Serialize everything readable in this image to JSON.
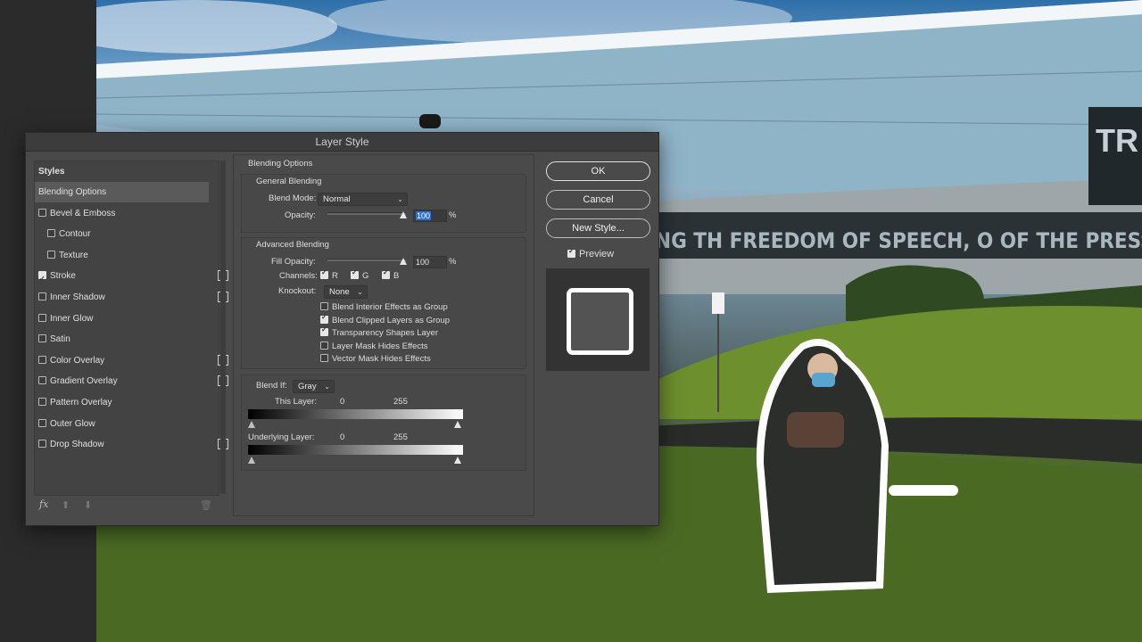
{
  "dialog": {
    "title": "Layer Style",
    "styles_header": "Styles",
    "styles": [
      {
        "label": "Blending Options",
        "checkbox": false,
        "checked": false,
        "active": true,
        "plus": false,
        "indent": false
      },
      {
        "label": "Bevel & Emboss",
        "checkbox": true,
        "checked": false,
        "active": false,
        "plus": false,
        "indent": false
      },
      {
        "label": "Contour",
        "checkbox": true,
        "checked": false,
        "active": false,
        "plus": false,
        "indent": true
      },
      {
        "label": "Texture",
        "checkbox": true,
        "checked": false,
        "active": false,
        "plus": false,
        "indent": true
      },
      {
        "label": "Stroke",
        "checkbox": true,
        "checked": true,
        "active": false,
        "plus": true,
        "indent": false
      },
      {
        "label": "Inner Shadow",
        "checkbox": true,
        "checked": false,
        "active": false,
        "plus": true,
        "indent": false
      },
      {
        "label": "Inner Glow",
        "checkbox": true,
        "checked": false,
        "active": false,
        "plus": false,
        "indent": false
      },
      {
        "label": "Satin",
        "checkbox": true,
        "checked": false,
        "active": false,
        "plus": false,
        "indent": false
      },
      {
        "label": "Color Overlay",
        "checkbox": true,
        "checked": false,
        "active": false,
        "plus": true,
        "indent": false
      },
      {
        "label": "Gradient Overlay",
        "checkbox": true,
        "checked": false,
        "active": false,
        "plus": true,
        "indent": false
      },
      {
        "label": "Pattern Overlay",
        "checkbox": true,
        "checked": false,
        "active": false,
        "plus": false,
        "indent": false
      },
      {
        "label": "Outer Glow",
        "checkbox": true,
        "checked": false,
        "active": false,
        "plus": false,
        "indent": false
      },
      {
        "label": "Drop Shadow",
        "checkbox": true,
        "checked": false,
        "active": false,
        "plus": true,
        "indent": false
      }
    ],
    "fx_label": "fx",
    "blending": {
      "section_title": "Blending Options",
      "general_title": "General Blending",
      "blend_mode_label": "Blend Mode:",
      "blend_mode_value": "Normal",
      "opacity_label": "Opacity:",
      "opacity_value": "100",
      "percent": "%",
      "advanced_title": "Advanced Blending",
      "fill_opacity_label": "Fill Opacity:",
      "fill_opacity_value": "100",
      "channels_label": "Channels:",
      "channel_r": "R",
      "channel_g": "G",
      "channel_b": "B",
      "knockout_label": "Knockout:",
      "knockout_value": "None",
      "options": [
        {
          "label": "Blend Interior Effects as Group",
          "checked": false
        },
        {
          "label": "Blend Clipped Layers as Group",
          "checked": true
        },
        {
          "label": "Transparency Shapes Layer",
          "checked": true
        },
        {
          "label": "Layer Mask Hides Effects",
          "checked": false
        },
        {
          "label": "Vector Mask Hides Effects",
          "checked": false
        }
      ],
      "blend_if_label": "Blend If:",
      "blend_if_value": "Gray",
      "this_layer_label": "This Layer:",
      "this_layer_min": "0",
      "this_layer_max": "255",
      "underlying_label": "Underlying Layer:",
      "underlying_min": "0",
      "underlying_max": "255"
    },
    "buttons": {
      "ok": "OK",
      "cancel": "Cancel",
      "new_style": "New Style...",
      "preview": "Preview"
    },
    "preview_checked": true
  },
  "canvas": {
    "banner_text": "NG TH  FREEDOM OF SPEECH, O  OF THE PRESS; OR THE  GHT OF TH",
    "building_sign": "TR",
    "colors": {
      "dialog_bg": "#4a4a4a",
      "selection": "#2e6fd0",
      "stroke": "#ffffff"
    }
  }
}
